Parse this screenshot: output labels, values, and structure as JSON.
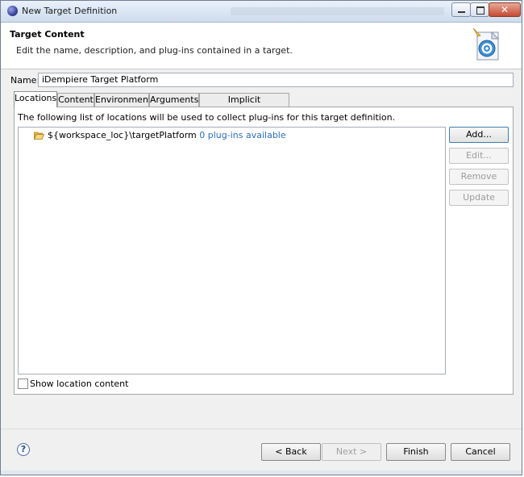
{
  "window": {
    "title": "New Target Definition"
  },
  "header": {
    "title": "Target Content",
    "description": "Edit the name, description, and plug-ins contained in a target."
  },
  "name_field": {
    "label": "Name:",
    "value": "iDempiere Target Platform"
  },
  "tabs": [
    {
      "label": "Locations",
      "active": true
    },
    {
      "label": "Content",
      "active": false
    },
    {
      "label": "Environment",
      "active": false
    },
    {
      "label": "Arguments",
      "active": false
    },
    {
      "label": "Implicit Dependencies",
      "active": false
    }
  ],
  "locations": {
    "description": "The following list of locations will be used to collect plug-ins for this target definition.",
    "items": [
      {
        "path": "${workspace_loc}\\targetPlatform",
        "status": "0 plug-ins available",
        "icon": "folder-open-icon"
      }
    ],
    "buttons": {
      "add": "Add...",
      "edit": "Edit...",
      "remove": "Remove",
      "update": "Update"
    },
    "show_content_label": "Show location content",
    "show_content_checked": false
  },
  "footer": {
    "back": "< Back",
    "next": "Next >",
    "finish": "Finish",
    "cancel": "Cancel",
    "help_glyph": "?"
  },
  "colors": {
    "link": "#2a6fb7",
    "titlebar": "#cfdcec",
    "disabled_text": "#9c9c9c"
  }
}
